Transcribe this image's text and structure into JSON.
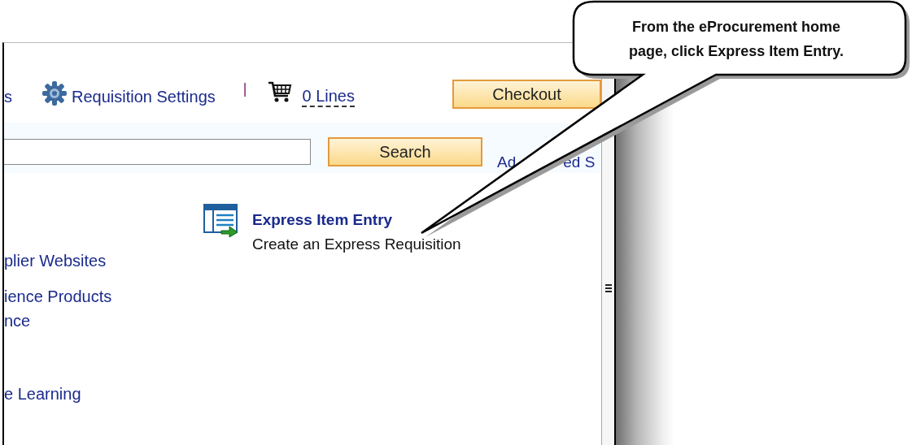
{
  "toolbar": {
    "partial_link": "s",
    "settings_link": "Requisition Settings",
    "separator": "|",
    "cart_link": "0 Lines",
    "checkout_button": "Checkout"
  },
  "search": {
    "button": "Search",
    "advanced_link_parts": [
      "Ad",
      "ed S"
    ]
  },
  "left_links": [
    {
      "text": "plier Websites"
    },
    {
      "text": "ience Products"
    },
    {
      "text": "nce"
    },
    {
      "text": "e Learning"
    }
  ],
  "express": {
    "title": "Express Item Entry",
    "description": "Create an Express Requisition"
  },
  "callout": {
    "text": "From the eProcurement home page, click Express Item Entry."
  }
}
